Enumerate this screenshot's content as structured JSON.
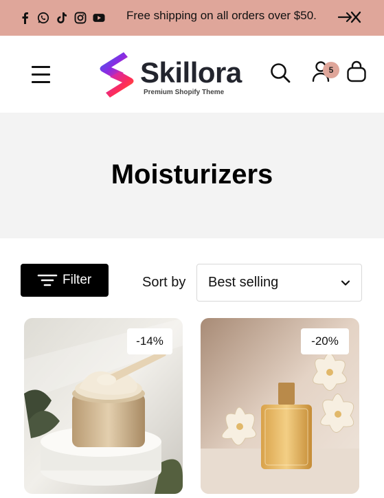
{
  "announcement": {
    "text": "Free shipping on all orders over $50.",
    "social_icons": [
      "facebook-icon",
      "whatsapp-icon",
      "tiktok-icon",
      "instagram-icon",
      "youtube-icon"
    ],
    "background": "#dfa69a"
  },
  "header": {
    "logo_name": "Skillora",
    "logo_tagline": "Premium Shopify Theme",
    "cart_count": "5"
  },
  "collection": {
    "title": "Moisturizers"
  },
  "toolbar": {
    "filter_label": "Filter",
    "sort_label": "Sort by",
    "sort_value": "Best selling"
  },
  "products": [
    {
      "discount": "-14%",
      "image": "cream-jar-image"
    },
    {
      "discount": "-20%",
      "image": "perfume-bottle-image"
    }
  ]
}
